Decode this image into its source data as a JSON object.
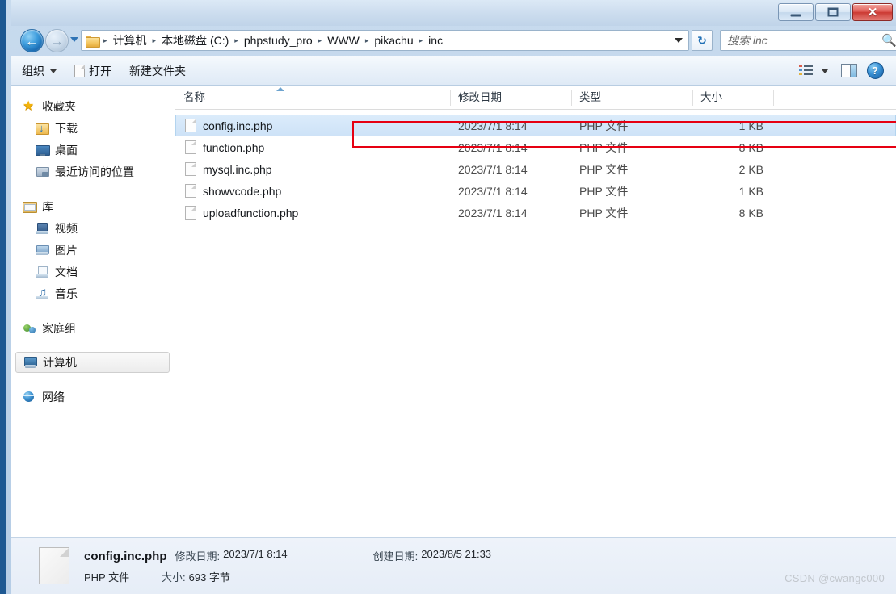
{
  "window": {
    "controls": {
      "minimize": "–",
      "maximize": "□",
      "close": "✕"
    }
  },
  "nav": {
    "back_label": "←",
    "forward_label": "→",
    "recent_dropdown": "recent-locations",
    "breadcrumb": [
      "计算机",
      "本地磁盘 (C:)",
      "phpstudy_pro",
      "WWW",
      "pikachu",
      "inc"
    ],
    "separator": "▸",
    "refresh_label": "↻"
  },
  "search": {
    "placeholder": "搜索 inc",
    "value": "",
    "icon": "search-icon"
  },
  "toolbar": {
    "organize_label": "组织",
    "open_label": "打开",
    "newfolder_label": "新建文件夹",
    "view_icon": "view-list-icon",
    "preview_icon": "preview-pane-icon",
    "help_icon": "help-icon",
    "help_glyph": "?"
  },
  "sidebar": {
    "groups": [
      {
        "header": {
          "label": "收藏夹",
          "icon": "ico-star",
          "glyph": "★"
        },
        "items": [
          {
            "label": "下载",
            "icon": "ico-download"
          },
          {
            "label": "桌面",
            "icon": "ico-desktop"
          },
          {
            "label": "最近访问的位置",
            "icon": "ico-recent"
          }
        ]
      },
      {
        "header": {
          "label": "库",
          "icon": "ico-library",
          "glyph": ""
        },
        "items": [
          {
            "label": "视频",
            "icon": "ico-video"
          },
          {
            "label": "图片",
            "icon": "ico-picture"
          },
          {
            "label": "文档",
            "icon": "ico-doc"
          },
          {
            "label": "音乐",
            "icon": "ico-music"
          }
        ]
      },
      {
        "header": {
          "label": "家庭组",
          "icon": "ico-homegroup",
          "glyph": ""
        },
        "items": []
      },
      {
        "header": {
          "label": "计算机",
          "icon": "ico-computer",
          "glyph": "",
          "selected": true
        },
        "items": []
      },
      {
        "header": {
          "label": "网络",
          "icon": "ico-network",
          "glyph": ""
        },
        "items": []
      }
    ]
  },
  "filelist": {
    "columns": [
      {
        "label": "名称",
        "sorted": "asc"
      },
      {
        "label": "修改日期"
      },
      {
        "label": "类型"
      },
      {
        "label": "大小"
      }
    ],
    "rows": [
      {
        "name": "config.inc.php",
        "date": "2023/7/1 8:14",
        "type": "PHP 文件",
        "size": "1 KB",
        "selected": true
      },
      {
        "name": "function.php",
        "date": "2023/7/1 8:14",
        "type": "PHP 文件",
        "size": "8 KB",
        "selected": false
      },
      {
        "name": "mysql.inc.php",
        "date": "2023/7/1 8:14",
        "type": "PHP 文件",
        "size": "2 KB",
        "selected": false
      },
      {
        "name": "showvcode.php",
        "date": "2023/7/1 8:14",
        "type": "PHP 文件",
        "size": "1 KB",
        "selected": false
      },
      {
        "name": "uploadfunction.php",
        "date": "2023/7/1 8:14",
        "type": "PHP 文件",
        "size": "8 KB",
        "selected": false
      }
    ]
  },
  "details": {
    "filename": "config.inc.php",
    "modified_label": "修改日期:",
    "modified_value": "2023/7/1 8:14",
    "created_label": "创建日期:",
    "created_value": "2023/8/5 21:33",
    "filetype": "PHP 文件",
    "size_label": "大小:",
    "size_value": "693 字节"
  },
  "watermark": "CSDN @cwangc000",
  "colors": {
    "accent": "#1d5892",
    "annotation": "#e60012",
    "selection": "#cde2f7",
    "close_button": "#cb3a33"
  }
}
